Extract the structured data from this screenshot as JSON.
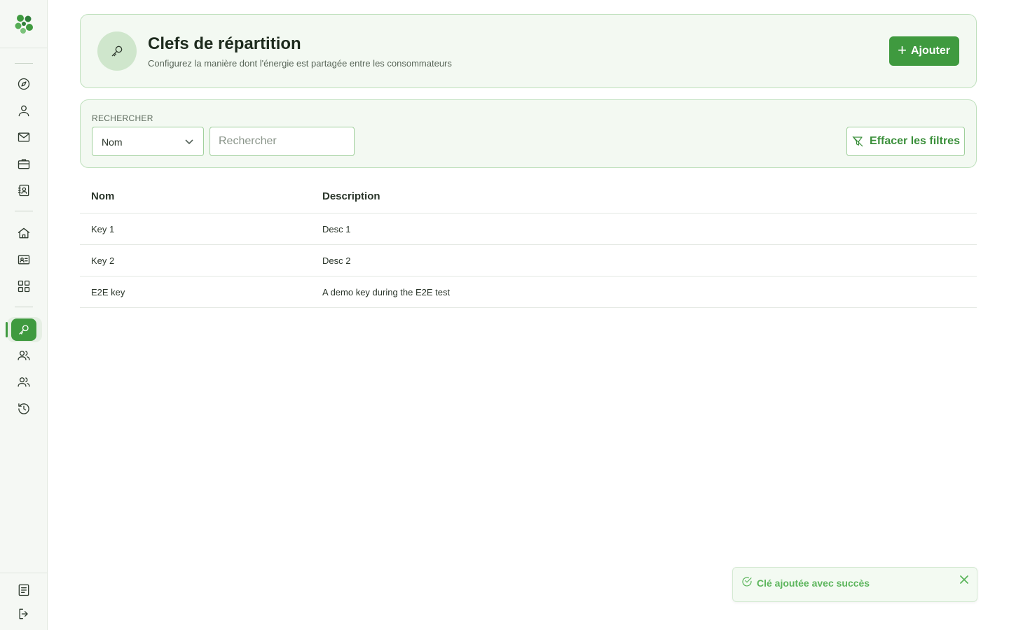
{
  "header": {
    "title": "Clefs de répartition",
    "subtitle": "Configurez la manière dont l'énergie est partagée entre les consommateurs",
    "add_label": "Ajouter",
    "icon": "key-icon"
  },
  "filters": {
    "label": "RECHERCHER",
    "field_select_value": "Nom",
    "search_placeholder": "Rechercher",
    "search_value": "",
    "clear_label": "Effacer les filtres"
  },
  "table": {
    "columns": [
      "Nom",
      "Description"
    ],
    "rows": [
      {
        "name": "Key 1",
        "description": "Desc 1"
      },
      {
        "name": "Key 2",
        "description": "Desc 2"
      },
      {
        "name": "E2E key",
        "description": "A demo key during the E2E test"
      }
    ]
  },
  "toast": {
    "message": "Clé ajoutée avec succès",
    "icon": "check-circle-icon"
  },
  "sidebar": {
    "items": [
      {
        "icon": "compass-icon"
      },
      {
        "icon": "user-icon"
      },
      {
        "icon": "mail-icon"
      },
      {
        "icon": "briefcase-icon"
      },
      {
        "icon": "contact-book-icon"
      },
      {
        "icon": "home-icon"
      },
      {
        "icon": "id-card-icon"
      },
      {
        "icon": "grid-icon"
      },
      {
        "icon": "key-icon",
        "active": true
      },
      {
        "icon": "users-icon"
      },
      {
        "icon": "users-icon"
      },
      {
        "icon": "history-icon"
      },
      {
        "icon": "document-icon"
      },
      {
        "icon": "logout-icon"
      }
    ]
  },
  "colors": {
    "brand": "#3f9a3f",
    "card_bg": "#f3f9f2",
    "card_border": "#bfe0bd",
    "toast_text": "#5cb55c"
  }
}
